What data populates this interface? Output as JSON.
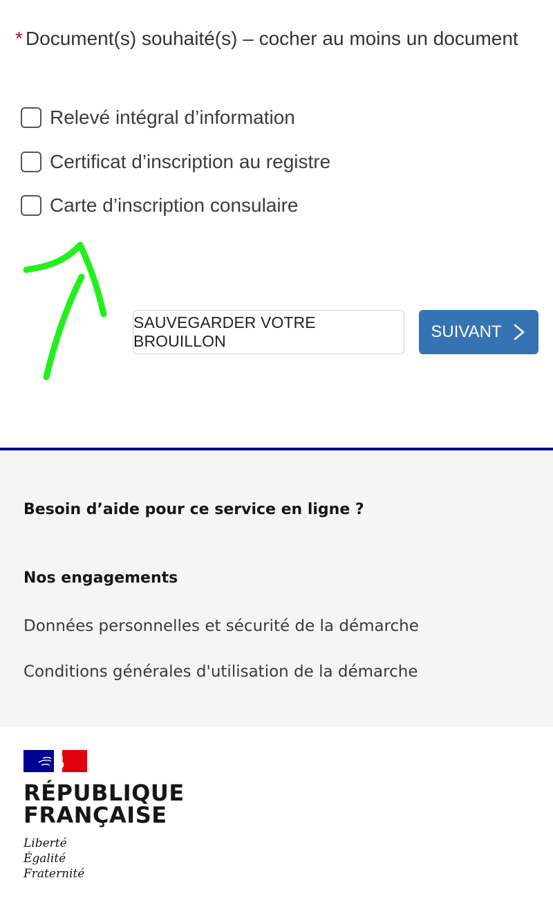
{
  "form": {
    "question": {
      "required_marker": "*",
      "label": "Document(s) souhaité(s) – cocher au moins un document"
    },
    "options": [
      {
        "label": "Relevé intégral d’information",
        "checked": false
      },
      {
        "label": "Certificat d’inscription au registre",
        "checked": false
      },
      {
        "label": "Carte d’inscription consulaire",
        "checked": false
      }
    ],
    "annotation": {
      "icon": "hand-drawn-arrow-icon",
      "color": "#22f01c"
    },
    "buttons": {
      "save_draft_label": "SAUVEGARDER VOTRE BROUILLON",
      "next_label": "SUIVANT",
      "next_icon": "chevron-right-icon",
      "next_color": "#3573b3"
    }
  },
  "footer": {
    "accent_color": "#000091",
    "help_title": "Besoin d’aide pour ce service en ligne ?",
    "engagements_title": "Nos engagements",
    "links": [
      "Données personnelles et sécurité de la démarche",
      "Conditions générales d'utilisation de la démarche"
    ],
    "brand": {
      "logo_icon": "marianne-logo-icon",
      "name_line1": "RÉPUBLIQUE",
      "name_line2": "FRANÇAISE",
      "motto": [
        "Liberté",
        "Égalité",
        "Fraternité"
      ]
    }
  }
}
